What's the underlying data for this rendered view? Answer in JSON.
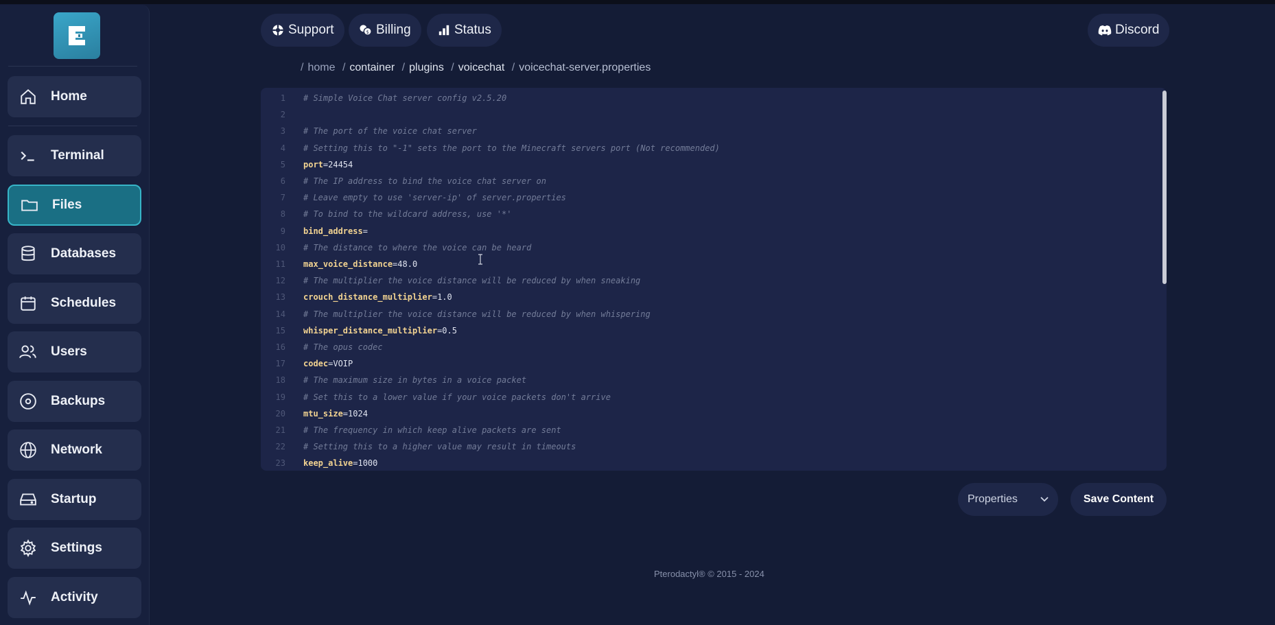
{
  "sidebar": {
    "items": [
      {
        "label": "Home",
        "icon": "home-icon"
      },
      {
        "label": "Terminal",
        "icon": "terminal-icon"
      },
      {
        "label": "Files",
        "icon": "folder-icon",
        "active": true
      },
      {
        "label": "Databases",
        "icon": "database-icon"
      },
      {
        "label": "Schedules",
        "icon": "calendar-icon"
      },
      {
        "label": "Users",
        "icon": "users-icon"
      },
      {
        "label": "Backups",
        "icon": "disc-icon"
      },
      {
        "label": "Network",
        "icon": "globe-icon"
      },
      {
        "label": "Startup",
        "icon": "drive-icon"
      },
      {
        "label": "Settings",
        "icon": "gear-icon"
      },
      {
        "label": "Activity",
        "icon": "activity-icon"
      }
    ]
  },
  "topnav": {
    "support": "Support",
    "billing": "Billing",
    "status": "Status",
    "discord": "Discord"
  },
  "breadcrumb": {
    "home": "home",
    "container": "container",
    "plugins": "plugins",
    "voicechat": "voicechat",
    "file": "voicechat-server.properties"
  },
  "editor": {
    "lines": [
      {
        "n": "1",
        "type": "comment",
        "text": "# Simple Voice Chat server config v2.5.20"
      },
      {
        "n": "2",
        "type": "blank",
        "text": ""
      },
      {
        "n": "3",
        "type": "comment",
        "text": "# The port of the voice chat server"
      },
      {
        "n": "4",
        "type": "comment",
        "text": "# Setting this to \"-1\" sets the port to the Minecraft servers port (Not recommended)"
      },
      {
        "n": "5",
        "type": "kv",
        "key": "port",
        "value": "=24454"
      },
      {
        "n": "6",
        "type": "comment",
        "text": "# The IP address to bind the voice chat server on"
      },
      {
        "n": "7",
        "type": "comment",
        "text": "# Leave empty to use 'server-ip' of server.properties"
      },
      {
        "n": "8",
        "type": "comment",
        "text": "# To bind to the wildcard address, use '*'"
      },
      {
        "n": "9",
        "type": "kv",
        "key": "bind_address",
        "value": "="
      },
      {
        "n": "10",
        "type": "comment",
        "text": "# The distance to where the voice can be heard"
      },
      {
        "n": "11",
        "type": "kv",
        "key": "max_voice_distance",
        "value": "=48.0"
      },
      {
        "n": "12",
        "type": "comment",
        "text": "# The multiplier the voice distance will be reduced by when sneaking"
      },
      {
        "n": "13",
        "type": "kv",
        "key": "crouch_distance_multiplier",
        "value": "=1.0"
      },
      {
        "n": "14",
        "type": "comment",
        "text": "# The multiplier the voice distance will be reduced by when whispering"
      },
      {
        "n": "15",
        "type": "kv",
        "key": "whisper_distance_multiplier",
        "value": "=0.5"
      },
      {
        "n": "16",
        "type": "comment",
        "text": "# The opus codec"
      },
      {
        "n": "17",
        "type": "kv",
        "key": "codec",
        "value": "=VOIP"
      },
      {
        "n": "18",
        "type": "comment",
        "text": "# The maximum size in bytes in a voice packet"
      },
      {
        "n": "19",
        "type": "comment",
        "text": "# Set this to a lower value if your voice packets don't arrive"
      },
      {
        "n": "20",
        "type": "kv",
        "key": "mtu_size",
        "value": "=1024"
      },
      {
        "n": "21",
        "type": "comment",
        "text": "# The frequency in which keep alive packets are sent"
      },
      {
        "n": "22",
        "type": "comment",
        "text": "# Setting this to a higher value may result in timeouts"
      },
      {
        "n": "23",
        "type": "kv",
        "key": "keep_alive",
        "value": "=1000"
      }
    ]
  },
  "controls": {
    "mode_selected": "Properties",
    "save_label": "Save Content"
  },
  "footer": {
    "text": "Pterodactyl® © 2015 - 2024"
  },
  "colors": {
    "background": "#141c36",
    "sidebar": "#17203d",
    "active_item": "#1a6f84",
    "active_border": "#37b5c8",
    "editor_bg": "#1d2548",
    "key_color": "#f2d391"
  }
}
